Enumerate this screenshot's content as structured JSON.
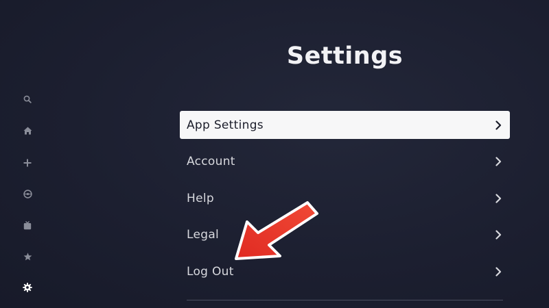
{
  "page": {
    "title": "Settings"
  },
  "sidebar": {
    "items": [
      {
        "icon": "search-icon"
      },
      {
        "icon": "home-icon"
      },
      {
        "icon": "plus-icon"
      },
      {
        "icon": "originals-icon"
      },
      {
        "icon": "tv-icon"
      },
      {
        "icon": "star-icon"
      },
      {
        "icon": "gear-icon",
        "active": true
      }
    ]
  },
  "menu": {
    "items": [
      {
        "label": "App Settings",
        "focused": true
      },
      {
        "label": "Account"
      },
      {
        "label": "Help"
      },
      {
        "label": "Legal"
      },
      {
        "label": "Log Out"
      }
    ]
  },
  "colors": {
    "background": "#1c1f30",
    "focus_bg": "#f7f7f8",
    "text": "#d8d9de",
    "icon_dim": "#8a8d99",
    "icon_active": "#ffffff",
    "annotation_arrow": "#e8362a"
  }
}
